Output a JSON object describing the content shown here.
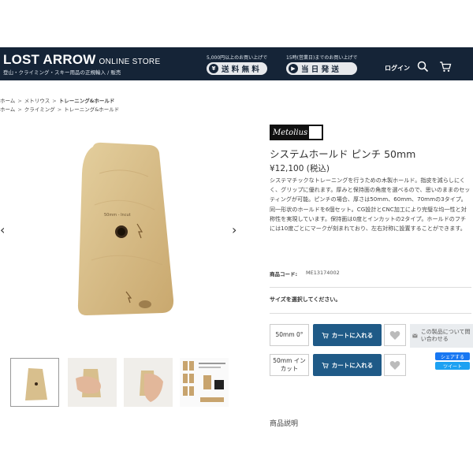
{
  "header": {
    "logo": "LOST ARROW",
    "logo_sub": "ONLINE STORE",
    "tagline": "登山・クライミング・スキー用品の正規輸入 / 販売",
    "promo1_top": "5,000円以上のお買い上げで",
    "promo1_label": "送 料 無 料",
    "promo2_top": "15時(営業日)までのお買い上げで",
    "promo2_label": "当 日 発 送",
    "login": "ログイン",
    "bg_color": "#152437"
  },
  "breadcrumbs": [
    {
      "items": [
        "ホーム",
        "メトリウス",
        "トレーニング&ホールド"
      ]
    },
    {
      "items": [
        "ホーム",
        "クライミング",
        "トレーニング&ホールド"
      ]
    }
  ],
  "main_image": {
    "overlay_text": "50mm - Incut"
  },
  "product": {
    "brand": "Metolius",
    "title": "システムホールド ピンチ 50mm",
    "price": "¥12,100 (税込)",
    "description": "システマチックなトレーニングを行うための木製ホールド。指皮を減らしにくく、グリップに優れます。厚みと保持面の角度を選べるので、思いのままのセッティングが可能。ピンチの場合、厚さは50mm、60mm、70mmの3タイプ。同一形状のホールドを6個セット。CG設計とCNC加工により完璧な均一性と対称性を実現しています。保持面は0度とインカットの2タイプ。ホールドのフチには10度ごとにマークが刻まれており、左右対称に設置することができます。",
    "code_label": "商品コード:",
    "code_value": "ME13174002",
    "size_prompt": "サイズを選択してください。"
  },
  "options": [
    {
      "label": "50mm 0°",
      "cart_label": "カートに入れる"
    },
    {
      "label": "50mm インカット",
      "cart_label": "カートに入れる"
    }
  ],
  "inquiry_label": "この製品について問い合わせる",
  "share": {
    "facebook": "シェアする",
    "twitter": "ツイート"
  },
  "section_heading": "商品説明",
  "colors": {
    "accent": "#1f5a87",
    "wood": "#d8bf8d"
  }
}
